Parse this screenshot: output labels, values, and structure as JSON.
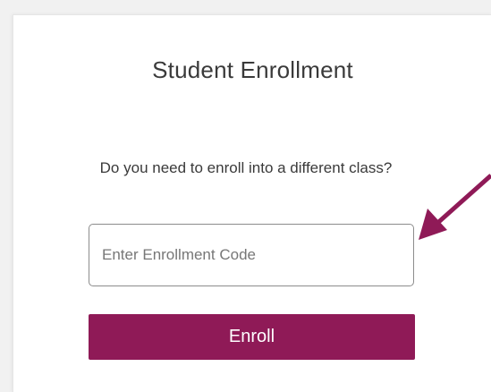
{
  "enrollment": {
    "title": "Student Enrollment",
    "prompt": "Do you need to enroll into a different class?",
    "code_placeholder": "Enter Enrollment Code",
    "code_value": "",
    "enroll_label": "Enroll"
  },
  "annotation": {
    "icon": "arrow-icon"
  },
  "colors": {
    "accent": "#8f1a57",
    "text": "#3a3a3a",
    "background": "#f1f1f1",
    "card": "#ffffff"
  }
}
